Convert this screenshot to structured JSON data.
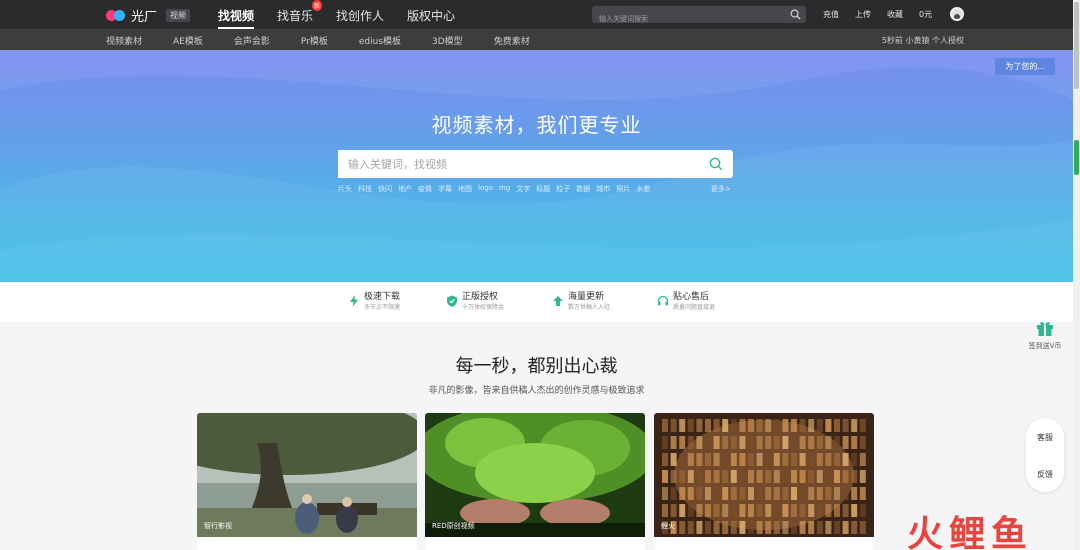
{
  "topbar": {
    "logo_text": "光厂",
    "logo_badge": "视频",
    "nav": [
      {
        "label": "找视频",
        "active": true
      },
      {
        "label": "找音乐",
        "badge": "新"
      },
      {
        "label": "找创作人"
      },
      {
        "label": "版权中心"
      }
    ],
    "search_placeholder": "输入关键词搜索",
    "links": [
      "充值",
      "上传",
      "收藏",
      "0元"
    ]
  },
  "subbar": {
    "items": [
      "视频素材",
      "AE模板",
      "会声会影",
      "Pr模板",
      "edius模板",
      "3D模型",
      "免费素材"
    ],
    "promo": "5秒前 小黄猿 个人授权"
  },
  "hero": {
    "tag": "为了您的...",
    "title": "视频素材，我们更专业",
    "search_placeholder": "输入关键词，找视频",
    "hot_keywords": [
      "片头",
      "科技",
      "快闪",
      "地产",
      "疫情",
      "字幕",
      "地图",
      "logo",
      "mg",
      "文字",
      "标题",
      "粒子",
      "数据",
      "城市",
      "照片",
      "水墨"
    ],
    "more": "更多>"
  },
  "features": [
    {
      "icon": "lightning-icon",
      "title": "极速下载",
      "sub": "多节点不限速"
    },
    {
      "icon": "shield-icon",
      "title": "正版授权",
      "sub": "十万体权保障金"
    },
    {
      "icon": "upload-arrow-icon",
      "title": "海量更新",
      "sub": "数万供稿人入驻"
    },
    {
      "icon": "headset-icon",
      "title": "贴心售后",
      "sub": "质量问题直接退"
    }
  ],
  "section": {
    "title": "每一秒，都别出心裁",
    "subtitle": "非凡的影像，皆来自供稿人杰出的创作灵感与极致追求",
    "cards": [
      {
        "caption": "智行影视"
      },
      {
        "caption": "RED原创视频"
      },
      {
        "caption": "鲤火"
      }
    ]
  },
  "float": {
    "gift_text": "签到送V币",
    "service": "客服",
    "feedback": "反馈"
  },
  "watermark": "火鲤鱼",
  "colors": {
    "topbar": "#2b2b2e",
    "subbar": "#3d3d40",
    "accent": "#2fb88f",
    "hero_top": "#7a8cf0",
    "hero_bottom": "#3fbfe9"
  }
}
